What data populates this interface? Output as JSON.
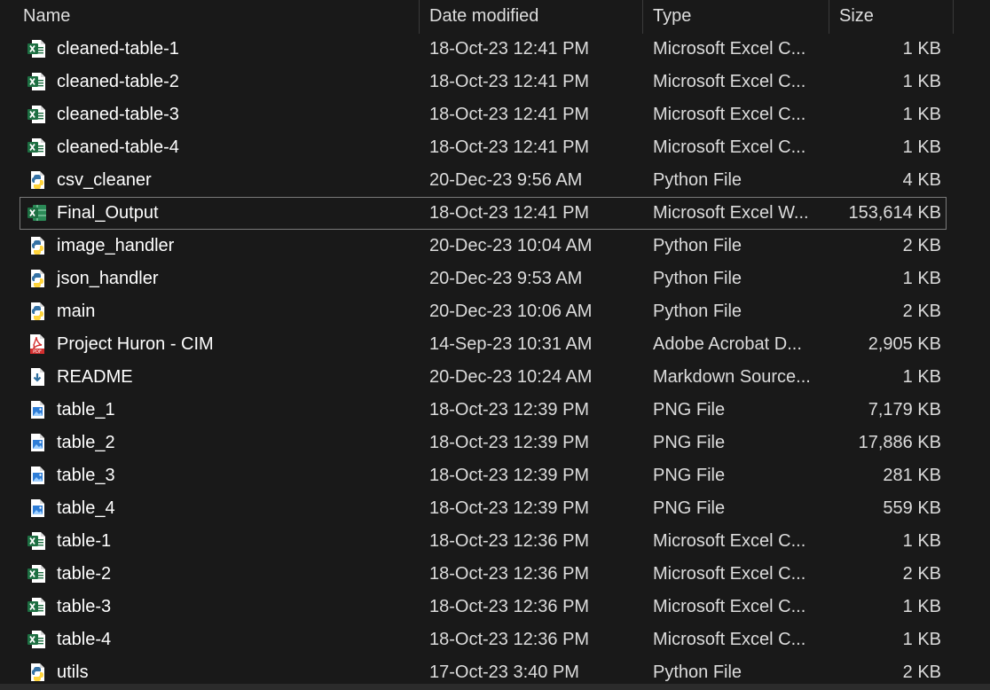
{
  "columns": {
    "name": "Name",
    "date": "Date modified",
    "type": "Type",
    "size": "Size"
  },
  "files": [
    {
      "name": "cleaned-table-1",
      "date": "18-Oct-23 12:41 PM",
      "type": "Microsoft Excel C...",
      "size": "1 KB",
      "icon": "excel-csv"
    },
    {
      "name": "cleaned-table-2",
      "date": "18-Oct-23 12:41 PM",
      "type": "Microsoft Excel C...",
      "size": "1 KB",
      "icon": "excel-csv"
    },
    {
      "name": "cleaned-table-3",
      "date": "18-Oct-23 12:41 PM",
      "type": "Microsoft Excel C...",
      "size": "1 KB",
      "icon": "excel-csv"
    },
    {
      "name": "cleaned-table-4",
      "date": "18-Oct-23 12:41 PM",
      "type": "Microsoft Excel C...",
      "size": "1 KB",
      "icon": "excel-csv"
    },
    {
      "name": "csv_cleaner",
      "date": "20-Dec-23 9:56 AM",
      "type": "Python File",
      "size": "4 KB",
      "icon": "python"
    },
    {
      "name": "Final_Output",
      "date": "18-Oct-23 12:41 PM",
      "type": "Microsoft Excel W...",
      "size": "153,614 KB",
      "icon": "excel-workbook",
      "selected": true
    },
    {
      "name": "image_handler",
      "date": "20-Dec-23 10:04 AM",
      "type": "Python File",
      "size": "2 KB",
      "icon": "python"
    },
    {
      "name": "json_handler",
      "date": "20-Dec-23 9:53 AM",
      "type": "Python File",
      "size": "1 KB",
      "icon": "python"
    },
    {
      "name": "main",
      "date": "20-Dec-23 10:06 AM",
      "type": "Python File",
      "size": "2 KB",
      "icon": "python"
    },
    {
      "name": "Project Huron - CIM",
      "date": "14-Sep-23 10:31 AM",
      "type": "Adobe Acrobat D...",
      "size": "2,905 KB",
      "icon": "pdf"
    },
    {
      "name": "README",
      "date": "20-Dec-23 10:24 AM",
      "type": "Markdown Source...",
      "size": "1 KB",
      "icon": "markdown"
    },
    {
      "name": "table_1",
      "date": "18-Oct-23 12:39 PM",
      "type": "PNG File",
      "size": "7,179 KB",
      "icon": "png"
    },
    {
      "name": "table_2",
      "date": "18-Oct-23 12:39 PM",
      "type": "PNG File",
      "size": "17,886 KB",
      "icon": "png"
    },
    {
      "name": "table_3",
      "date": "18-Oct-23 12:39 PM",
      "type": "PNG File",
      "size": "281 KB",
      "icon": "png"
    },
    {
      "name": "table_4",
      "date": "18-Oct-23 12:39 PM",
      "type": "PNG File",
      "size": "559 KB",
      "icon": "png"
    },
    {
      "name": "table-1",
      "date": "18-Oct-23 12:36 PM",
      "type": "Microsoft Excel C...",
      "size": "1 KB",
      "icon": "excel-csv"
    },
    {
      "name": "table-2",
      "date": "18-Oct-23 12:36 PM",
      "type": "Microsoft Excel C...",
      "size": "2 KB",
      "icon": "excel-csv"
    },
    {
      "name": "table-3",
      "date": "18-Oct-23 12:36 PM",
      "type": "Microsoft Excel C...",
      "size": "1 KB",
      "icon": "excel-csv"
    },
    {
      "name": "table-4",
      "date": "18-Oct-23 12:36 PM",
      "type": "Microsoft Excel C...",
      "size": "1 KB",
      "icon": "excel-csv"
    },
    {
      "name": "utils",
      "date": "17-Oct-23 3:40 PM",
      "type": "Python File",
      "size": "2 KB",
      "icon": "python"
    }
  ],
  "colors": {
    "background": "#191919",
    "excel_green": "#1d6f42",
    "python_blue": "#3572a5",
    "python_yellow": "#ffd43b",
    "pdf_red": "#d32f2f",
    "png_blue": "#2e7dd7"
  }
}
